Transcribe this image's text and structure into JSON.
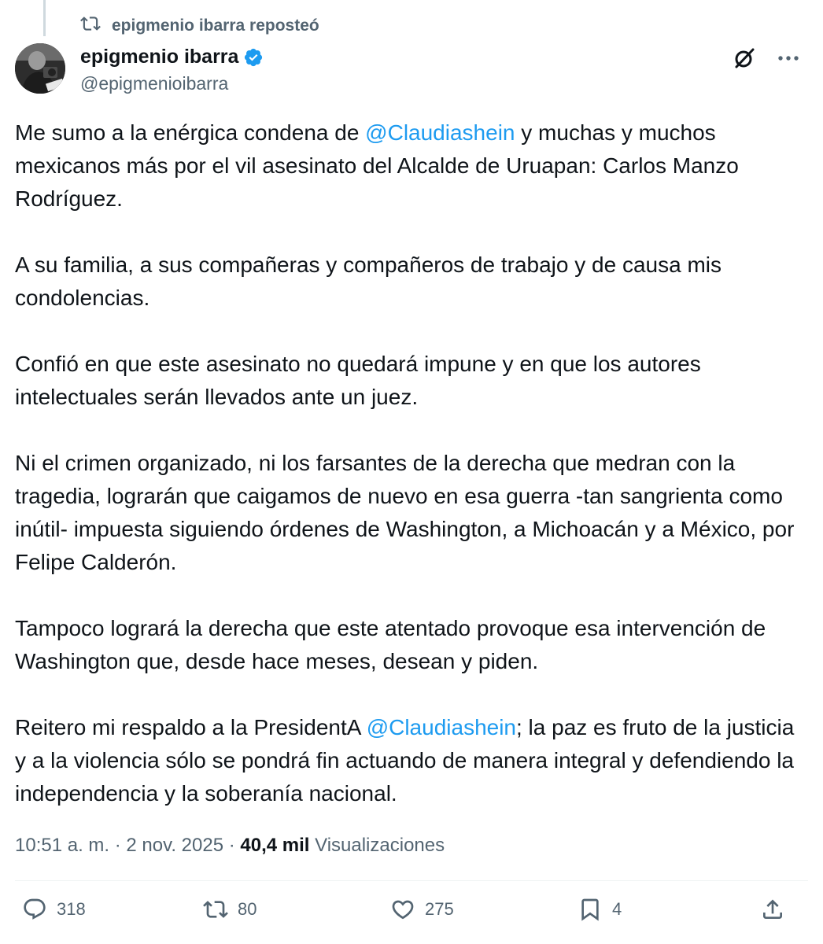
{
  "repost": {
    "label": "epigmenio ibarra reposteó"
  },
  "author": {
    "name": "epigmenio ibarra",
    "handle": "@epigmenioibarra"
  },
  "post": {
    "p1": {
      "before": "Me sumo a la enérgica condena de ",
      "mention": "@Claudiashein",
      "after": " y muchas y muchos mexicanos más por el vil asesinato del Alcalde de Uruapan: Carlos Manzo Rodríguez."
    },
    "p2": "A su familia, a sus compañeras y compañeros de trabajo y de causa mis condolencias.",
    "p3": "Confió en que este asesinato no quedará impune y en que los autores intelectuales serán llevados ante un juez.",
    "p4": "Ni el crimen organizado, ni los farsantes de la derecha que medran con la tragedia, lograrán que caigamos de nuevo en esa guerra -tan sangrienta como inútil- impuesta siguiendo órdenes de Washington, a Michoacán y a México, por Felipe Calderón.",
    "p5": "Tampoco logrará la derecha que este atentado provoque esa intervención de Washington que, desde hace meses, desean y piden.",
    "p6": {
      "before": "Reitero mi respaldo a la PresidentA ",
      "mention": "@Claudiashein",
      "after": "; la paz es fruto de la justicia y a la violencia sólo se pondrá fin actuando de manera integral y defendiendo la independencia y la soberanía nacional."
    }
  },
  "meta": {
    "time": "10:51 a. m.",
    "sep": " · ",
    "date": "2 nov. 2025",
    "views_count": "40,4 mil",
    "views_label": "Visualizaciones"
  },
  "stats": {
    "replies": "318",
    "reposts": "80",
    "likes": "275",
    "bookmarks": "4"
  },
  "icons": {
    "repost": "repost-icon",
    "verified": "verified-badge-icon",
    "grok": "grok-icon",
    "more": "more-icon",
    "reply": "reply-icon",
    "like": "like-icon",
    "bookmark": "bookmark-icon",
    "share": "share-icon"
  },
  "colors": {
    "text": "#0f1419",
    "secondary": "#536471",
    "mention": "#1d9bf0",
    "verified": "#1d9bf0",
    "divider": "#eff3f4"
  }
}
